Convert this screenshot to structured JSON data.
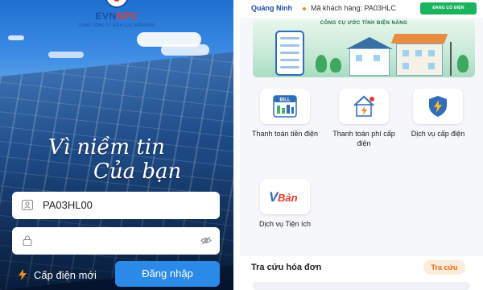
{
  "login": {
    "logo_evn": "EVN",
    "logo_npc": "NPC",
    "logo_subtitle": "TỔNG CÔNG TY ĐIỆN LỰC MIỀN BẮC",
    "slogan_line1": "Vì niềm tin",
    "slogan_line2": "Của bạn",
    "username_value": "PA03HL00",
    "password_value": "",
    "new_supply_label": "Cấp điện mới",
    "login_label": "Đăng nhập",
    "colors": {
      "primary_button": "#2b8ae8",
      "brand_blue": "#1a4fa3",
      "brand_red": "#e63b2e"
    }
  },
  "home": {
    "province": "Quảng Ninh",
    "customer_code": "Mã khách hàng: PA03HLC",
    "status_badge": "ĐANG CÓ ĐIỆN",
    "banner_title": "CÔNG CỤ ƯỚC TÍNH ĐIỆN NĂNG",
    "tiles": [
      {
        "label": "Thanh toán tiền điện",
        "icon": "bill-icon"
      },
      {
        "label": "Thanh toán phí cấp điện",
        "icon": "house-plug-icon"
      },
      {
        "label": "Dịch vụ cấp điện",
        "icon": "shield-bolt-icon"
      },
      {
        "label": "Dịch vụ Tiện ích",
        "icon": "vban-logo-icon"
      }
    ],
    "tile_icon_bill_text": "BILL",
    "tile_icon_vban_text": "Bản",
    "invoice_section_title": "Tra cứu hóa đơn",
    "invoice_search_label": "Tra cứu",
    "colors": {
      "badge": "#1bb45e",
      "accent_orange": "#e06d12"
    }
  }
}
